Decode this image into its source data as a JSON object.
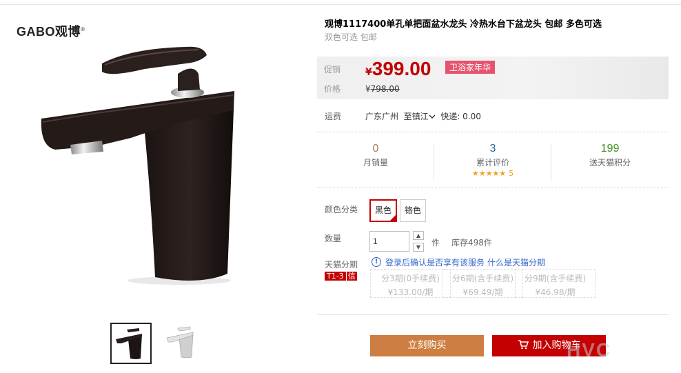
{
  "brand": {
    "name": "GABO观博",
    "reg": "®"
  },
  "product": {
    "title": "观博1117400单孔单把面盆水龙头 冷热水台下盆龙头 包邮 多色可选",
    "subtitle": "双色可选 包邮"
  },
  "price": {
    "promo_label": "促销",
    "promo_symbol": "¥",
    "promo_value": "399.00",
    "promo_tag": "卫浴家年华",
    "orig_label": "价格",
    "orig_symbol": "¥",
    "orig_value": "798.00"
  },
  "shipping": {
    "label": "运费",
    "from": "广东广州",
    "to": "至镇江",
    "method": "快递: 0.00"
  },
  "stats": [
    {
      "value": "0",
      "label": "月销量",
      "color": "#a87c50"
    },
    {
      "value": "3",
      "label": "累计评价",
      "color": "#2a6496",
      "stars": "★★★★★",
      "stars_count": "5"
    },
    {
      "value": "199",
      "label": "送天猫积分",
      "color": "#3a8d1e"
    }
  ],
  "sku": {
    "label": "颜色分类",
    "options": [
      {
        "label": "黑色",
        "selected": true
      },
      {
        "label": "铬色",
        "selected": false
      }
    ]
  },
  "quantity": {
    "label": "数量",
    "value": "1",
    "up": "▲",
    "down": "▼",
    "unit": "件",
    "stock": "库存498件"
  },
  "installment": {
    "label": "天猫分期",
    "tag_a": "T1-3",
    "tag_b": "信",
    "notice": "登录后确认是否享有该服务",
    "link": "什么是天猫分期",
    "plans": [
      {
        "period": "分3期(0手续费)",
        "amount": "¥133.00/期"
      },
      {
        "period": "分6期(含手续费)",
        "amount": "¥69.49/期"
      },
      {
        "period": "分9期(含手续费)",
        "amount": "¥46.98/期"
      }
    ]
  },
  "actions": {
    "buy_now": "立刻购买",
    "add_cart": "加入购物车"
  },
  "watermark": "HVC",
  "colors": {
    "accent": "#c40000",
    "buy": "#cd7e42",
    "link": "#3366cc"
  }
}
